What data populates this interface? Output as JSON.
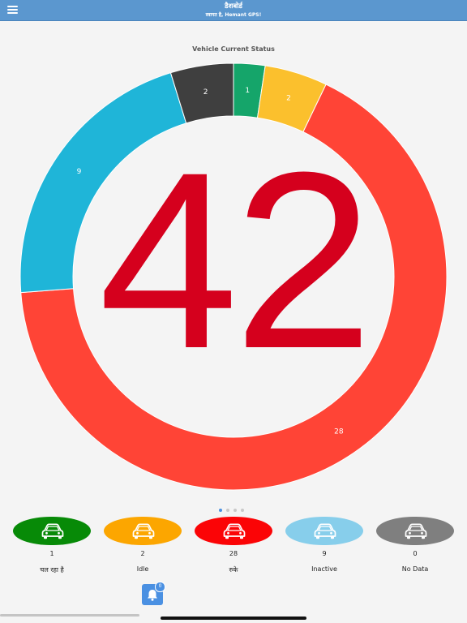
{
  "header": {
    "title": "डैशबोर्ड",
    "subtitle": "स्वागत है, Hemant GPS!",
    "bg_color": "#5b97cf"
  },
  "chart_data": {
    "type": "pie",
    "title": "Vehicle Current Status",
    "center_label": "42",
    "slices": [
      {
        "value": 1,
        "label": "1",
        "color": "#15a56a"
      },
      {
        "value": 2,
        "label": "2",
        "color": "#fbc02d"
      },
      {
        "value": 28,
        "label": "28",
        "color": "#ff4436"
      },
      {
        "value": 9,
        "label": "9",
        "color": "#1fb5d8"
      },
      {
        "value": 2,
        "label": "2",
        "color": "#3f3f3f"
      }
    ]
  },
  "pager": {
    "count": 4,
    "active": 0
  },
  "status_items": [
    {
      "count": "1",
      "label": "चल रहा है",
      "color": "#078a07",
      "icon": "car-icon"
    },
    {
      "count": "2",
      "label": "Idle",
      "color": "#fca600",
      "icon": "car-icon"
    },
    {
      "count": "28",
      "label": "रुके",
      "color": "#fb0406",
      "icon": "car-icon"
    },
    {
      "count": "9",
      "label": "Inactive",
      "color": "#87ceeb",
      "icon": "car-icon"
    },
    {
      "count": "0",
      "label": "No Data",
      "color": "#7f7f7f",
      "icon": "car-icon"
    }
  ],
  "notification": {
    "badge": "0",
    "icon": "bell-icon"
  }
}
